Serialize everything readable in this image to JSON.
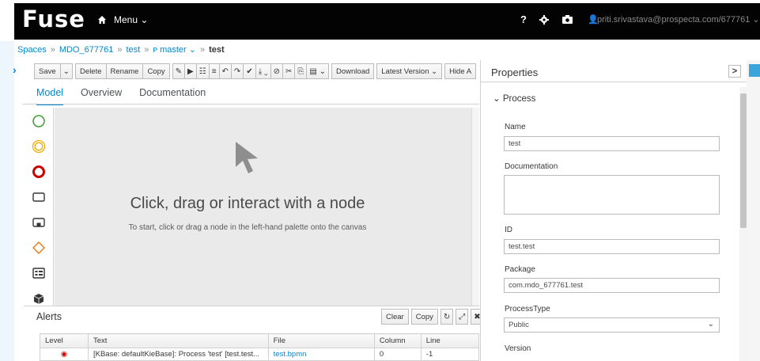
{
  "header": {
    "brand": "Fuse",
    "menu_label": "Menu ⌄",
    "help_label": "?",
    "user_email": "priti.srivastava@prospecta.com/677761 ⌄"
  },
  "breadcrumb": {
    "items": [
      "Spaces",
      "MDO_677761",
      "test",
      "ᴘ master ⌄",
      "test"
    ]
  },
  "toolbar": {
    "buttons": [
      "Save",
      "⌄",
      "Delete",
      "Rename",
      "Copy",
      "✎",
      "▶",
      "☷",
      "≡",
      "↶",
      "↷",
      "✔",
      "⤓ ⌄",
      "⊘",
      "✂",
      "⎘",
      "▤ ⌄",
      "Download",
      "Latest Version ⌄",
      "Hide A"
    ]
  },
  "tabs": [
    "Model",
    "Overview",
    "Documentation"
  ],
  "palette": [
    "start-event-icon",
    "intermediate-event-icon",
    "end-event-icon",
    "task-icon",
    "subprocess-icon",
    "gateway-icon",
    "lane-icon",
    "artifacts-icon"
  ],
  "canvas": {
    "title": "Click, drag or interact with a node",
    "subtitle": "To start, click or drag a node in the left-hand palette onto the canvas"
  },
  "alerts": {
    "title": "Alerts",
    "tools": [
      "Clear",
      "Copy",
      "↻",
      "⤢",
      "✖"
    ],
    "columns": [
      "Level",
      "Text",
      "File",
      "Column",
      "Line"
    ],
    "rows": [
      {
        "level": "◉",
        "text": "[KBase: defaultKieBase]: Process 'test' [test.test...",
        "file": "test.bpmn",
        "column": "0",
        "line": "-1"
      }
    ]
  },
  "properties": {
    "title": "Properties",
    "toggle": ">",
    "section": "⌄ Process",
    "name_label": "Name",
    "name_value": "test",
    "documentation_label": "Documentation",
    "documentation_value": "",
    "id_label": "ID",
    "id_value": "test.test",
    "package_label": "Package",
    "package_value": "com.mdo_677761.test",
    "process_type_label": "ProcessType",
    "process_type_value": "Public",
    "version_label": "Version"
  },
  "colors": {
    "accent": "#0088ce",
    "header_bg": "#030303",
    "canvas_bg": "#eaeaea",
    "start_event": "#3f9c35",
    "intermediate_event": "#f0ab00",
    "end_event": "#cc0000",
    "gateway": "#ec7a08"
  }
}
